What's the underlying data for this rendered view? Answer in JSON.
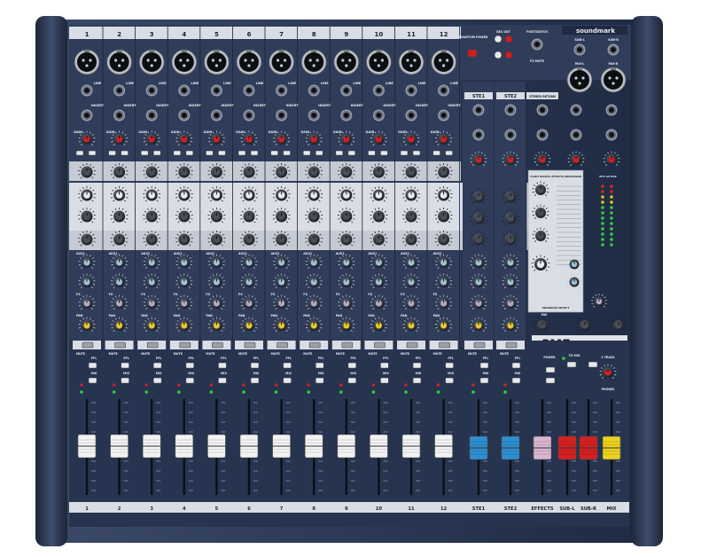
{
  "brand": {
    "name": "soundmark",
    "model": "SMF",
    "fx_title": "24-BIT DIGITAL EFFECTS PROCESSOR",
    "fx_active": "EFX ACTIVE"
  },
  "colors": {
    "chassis": "#27344f",
    "chassis_edge": "#1a2235",
    "panel": "#d9dde4",
    "panel_strip": "#c5cad3",
    "gain_red": "#d0202a",
    "aux_blue": "#9cc4d8",
    "fx_lilac": "#b3a8cc",
    "pan_yellow": "#e8c830",
    "fader_white": "#f2f2f2",
    "fader_blue": "#2c8fd0",
    "fader_pink": "#d9b6d0",
    "fader_red": "#d42020",
    "fader_yellow": "#ecd020"
  },
  "channels": {
    "mono": [
      "1",
      "2",
      "3",
      "4",
      "5",
      "6",
      "7",
      "8",
      "9",
      "10",
      "11",
      "12"
    ],
    "stereo": [
      "STE1",
      "STE2"
    ]
  },
  "knob_labels": {
    "gain": "GAIN",
    "hi": "HI",
    "mid": "MID",
    "lo": "LO",
    "aux1": "AUX1",
    "aux2": "AUX2",
    "fx": "FX",
    "pan": "PAN",
    "line": "LINE",
    "insert": "INSERT"
  },
  "buttons": {
    "mute": "MUTE",
    "pfl": "PFL",
    "sub": "SUB",
    "mix": "MIX"
  },
  "master_top": {
    "phantom": "PHANTOM POWER",
    "rec_out": "REC OUT",
    "footswitch": "FOOTSWITCH",
    "fx_mute": "FX MUTE",
    "stereo1": "STEREO 1",
    "stereo2": "STEREO 2",
    "stereo_return": "STEREO RETURN",
    "mix_l": "MIX-L",
    "mix_r": "MIX-R",
    "sub_l": "SUB-L",
    "sub_r": "SUB-R",
    "program_select": "PROGRAM SELECT"
  },
  "bottom_labels": [
    "1",
    "2",
    "3",
    "4",
    "5",
    "6",
    "7",
    "8",
    "9",
    "10",
    "11",
    "12",
    "STE1",
    "STE2",
    "EFFECTS",
    "SUB-L",
    "SUB-R",
    "MIX"
  ],
  "master_buttons": {
    "to_mix": "TO MIX",
    "two_track": "2 TRACK",
    "power": "POWER",
    "efx": "EFX",
    "phones": "PHONES"
  }
}
